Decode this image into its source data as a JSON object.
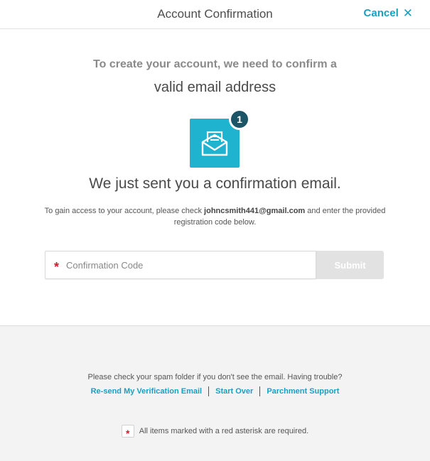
{
  "header": {
    "title": "Account Confirmation",
    "cancel_label": "Cancel",
    "cancel_icon": "close-icon"
  },
  "intro": {
    "line1": "To create your account, we need to confirm a",
    "line2": "valid email address"
  },
  "mail_icon": {
    "icon": "open-envelope-icon",
    "badge_count": "1",
    "accent_color": "#1fb3d0",
    "badge_color": "#1c5565"
  },
  "heading": "We just sent you a confirmation email.",
  "instructions": {
    "before": "To gain access to your account, please check ",
    "email": "johncsmith441@gmail.com",
    "after": " and enter the provided registration code below."
  },
  "form": {
    "required_marker": "*",
    "code_placeholder": "Confirmation Code",
    "code_value": "",
    "submit_label": "Submit"
  },
  "footer": {
    "spam_note": "Please check your spam folder if you don't see the email. Having trouble?",
    "links": {
      "resend": "Re-send My Verification Email",
      "start_over": "Start Over",
      "support": "Parchment Support"
    },
    "required_marker": "*",
    "required_note": "All items marked with a red asterisk are required."
  }
}
